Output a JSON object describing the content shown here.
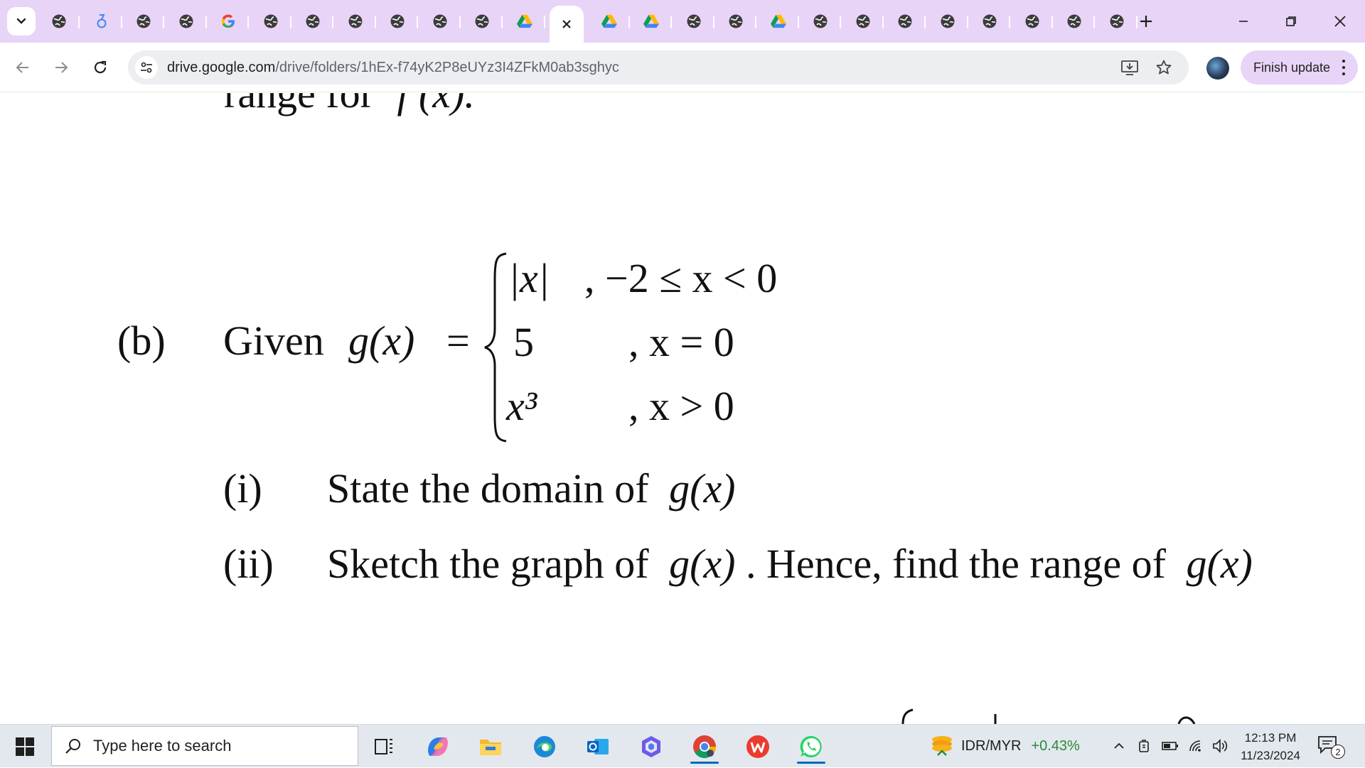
{
  "browser": {
    "url_host": "drive.google.com",
    "url_path": "/drive/folders/1hEx-f74yK2P8eUYz3I4ZFkM0ab3sghyc",
    "finish_update_label": "Finish update",
    "tab_icons": [
      "globe-icon",
      "translate-icon",
      "globe-icon",
      "globe-icon",
      "google-icon",
      "globe-icon",
      "globe-icon",
      "globe-icon",
      "globe-icon",
      "globe-icon",
      "globe-icon",
      "google-drive-icon",
      "active-tab-close-icon",
      "google-drive-icon",
      "google-drive-icon",
      "globe-icon",
      "globe-icon",
      "google-drive-icon",
      "globe-icon",
      "globe-icon",
      "globe-icon",
      "globe-icon",
      "globe-icon",
      "globe-icon",
      "globe-icon",
      "globe-icon"
    ],
    "accent_color": "#e8d4f7"
  },
  "document": {
    "top_partial": "range for",
    "top_partial_func": "f (x).",
    "part_label": "(b)",
    "given_word": "Given",
    "g_of_x": "g(x)",
    "equals": "=",
    "cases": [
      {
        "expr": "|x|",
        "cond": ", −2 ≤ x < 0"
      },
      {
        "expr": "5",
        "cond": ", x = 0"
      },
      {
        "expr": "x³",
        "cond": ", x > 0"
      }
    ],
    "q1_label": "(i)",
    "q1_text": "State the domain of",
    "q1_func": "g(x)",
    "q2_label": "(ii)",
    "q2_text": "Sketch the graph of",
    "q2_func": "g(x)",
    "q2_text2": ". Hence, find the range of",
    "q2_func2": "g(x)"
  },
  "taskbar": {
    "search_placeholder": "Type here to search",
    "ticker_name": "IDR/MYR",
    "ticker_change": "+0.43%",
    "time": "12:13 PM",
    "date": "11/23/2024",
    "notification_count": "2"
  }
}
